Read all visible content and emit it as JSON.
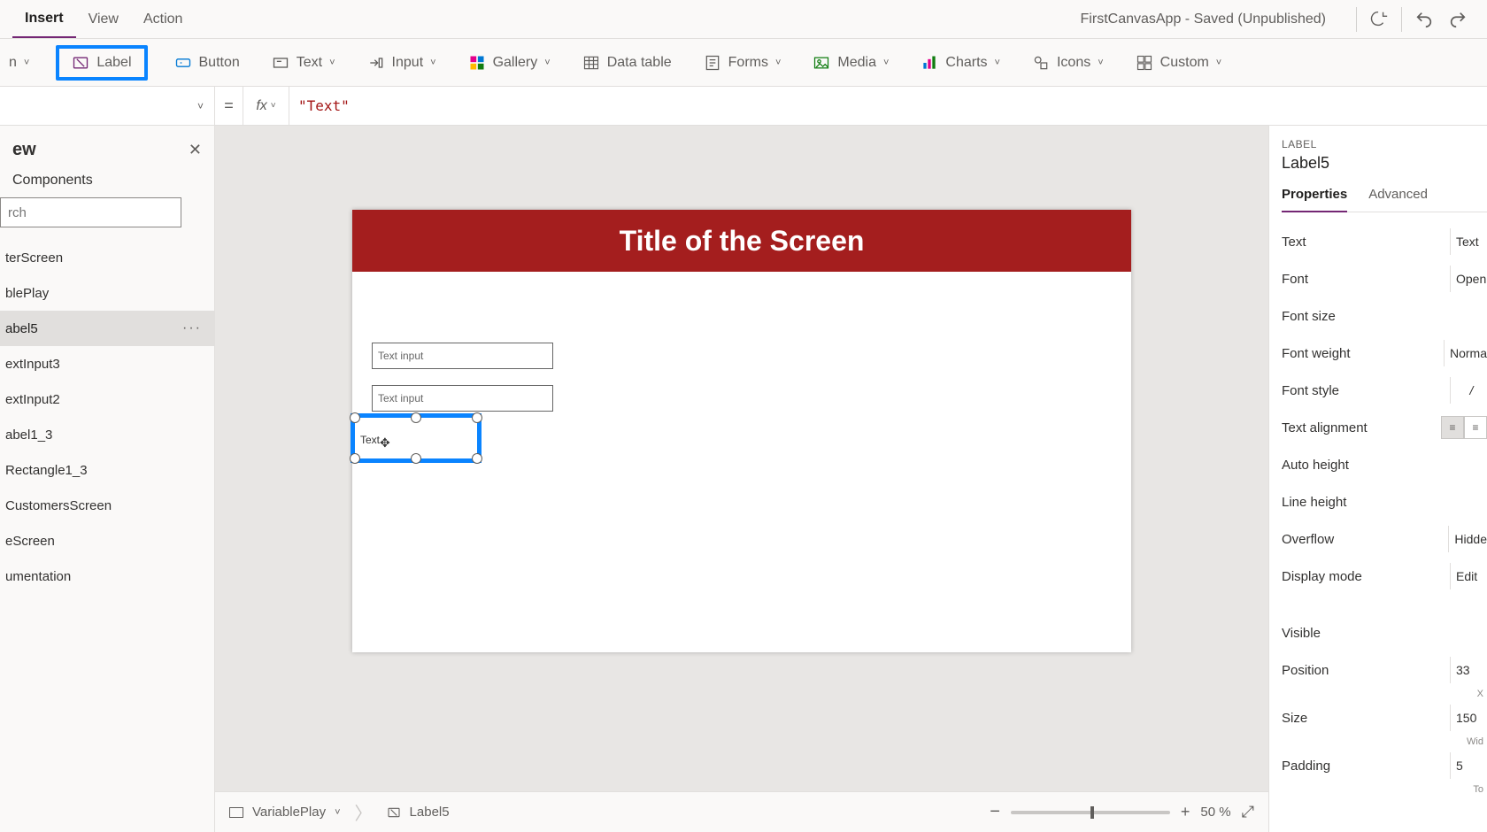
{
  "menubar": {
    "tabs": {
      "insert": "Insert",
      "view": "View",
      "action": "Action"
    },
    "title": "FirstCanvasApp - Saved (Unpublished)"
  },
  "ribbon": {
    "truncated_chev": "˅",
    "label": "Label",
    "button": "Button",
    "text": "Text",
    "input": "Input",
    "gallery": "Gallery",
    "datatable": "Data table",
    "forms": "Forms",
    "media": "Media",
    "charts": "Charts",
    "icons": "Icons",
    "custom": "Custom"
  },
  "formula": {
    "equals": "=",
    "fx": "fx",
    "value": "\"Text\""
  },
  "tree": {
    "title": "ew",
    "tab_components": "Components",
    "search_placeholder": "rch",
    "items": [
      {
        "label": "terScreen"
      },
      {
        "label": "blePlay"
      },
      {
        "label": "abel5",
        "selected": true
      },
      {
        "label": "extInput3"
      },
      {
        "label": "extInput2"
      },
      {
        "label": "abel1_3"
      },
      {
        "label": "Rectangle1_3"
      },
      {
        "label": "CustomersScreen"
      },
      {
        "label": "eScreen"
      },
      {
        "label": "umentation"
      }
    ],
    "more": "···"
  },
  "canvas": {
    "banner": "Title of the Screen",
    "textinput_placeholder": "Text input",
    "label_text": "Text"
  },
  "statusbar": {
    "screen": "VariablePlay",
    "control": "Label5",
    "zoom_pct": "50",
    "zoom_unit": "%",
    "minus": "−",
    "plus": "+"
  },
  "props": {
    "category": "LABEL",
    "name": "Label5",
    "tab_properties": "Properties",
    "tab_advanced": "Advanced",
    "rows": {
      "text": {
        "label": "Text",
        "value": "Text"
      },
      "font": {
        "label": "Font",
        "value": "Open"
      },
      "fontsize": {
        "label": "Font size"
      },
      "fontweight": {
        "label": "Font weight",
        "value": "Norma"
      },
      "fontstyle": {
        "label": "Font style",
        "value": "/"
      },
      "textalignment": {
        "label": "Text alignment"
      },
      "autoheight": {
        "label": "Auto height"
      },
      "lineheight": {
        "label": "Line height"
      },
      "overflow": {
        "label": "Overflow",
        "value": "Hidde"
      },
      "displaymode": {
        "label": "Display mode",
        "value": "Edit"
      },
      "visible": {
        "label": "Visible"
      },
      "position": {
        "label": "Position",
        "value": "33",
        "sub": "X"
      },
      "size": {
        "label": "Size",
        "value": "150",
        "sub": "Wid"
      },
      "padding": {
        "label": "Padding",
        "value": "5",
        "sub": "To"
      }
    }
  }
}
